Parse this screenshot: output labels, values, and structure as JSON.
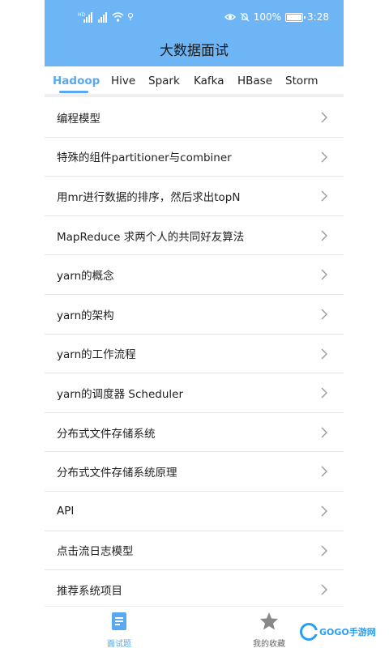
{
  "status_bar": {
    "battery": "100%",
    "time": "3:28",
    "network_tag": "HD"
  },
  "app_title": "大数据面试",
  "tabs": [
    {
      "label": "Hadoop",
      "active": true
    },
    {
      "label": "Hive",
      "active": false
    },
    {
      "label": "Spark",
      "active": false
    },
    {
      "label": "Kafka",
      "active": false
    },
    {
      "label": "HBase",
      "active": false
    },
    {
      "label": "Storm",
      "active": false
    }
  ],
  "list": {
    "items": [
      "编程模型",
      "特殊的组件partitioner与combiner",
      "用mr进行数据的排序，然后求出topN",
      "MapReduce 求两个人的共同好友算法",
      "yarn的概念",
      "yarn的架构",
      "yarn的工作流程",
      "yarn的调度器 Scheduler",
      "分布式文件存储系统",
      "分布式文件存储系统原理",
      "API",
      "点击流日志模型",
      "推荐系统项目"
    ]
  },
  "bottom_nav": {
    "left_label": "面试题",
    "right_label": "我的收藏"
  },
  "watermark": {
    "text": "GOGO手游网"
  },
  "colors": {
    "header": "#6eb5f6",
    "accent": "#5aa8ef",
    "divider": "#e5e5e5"
  }
}
